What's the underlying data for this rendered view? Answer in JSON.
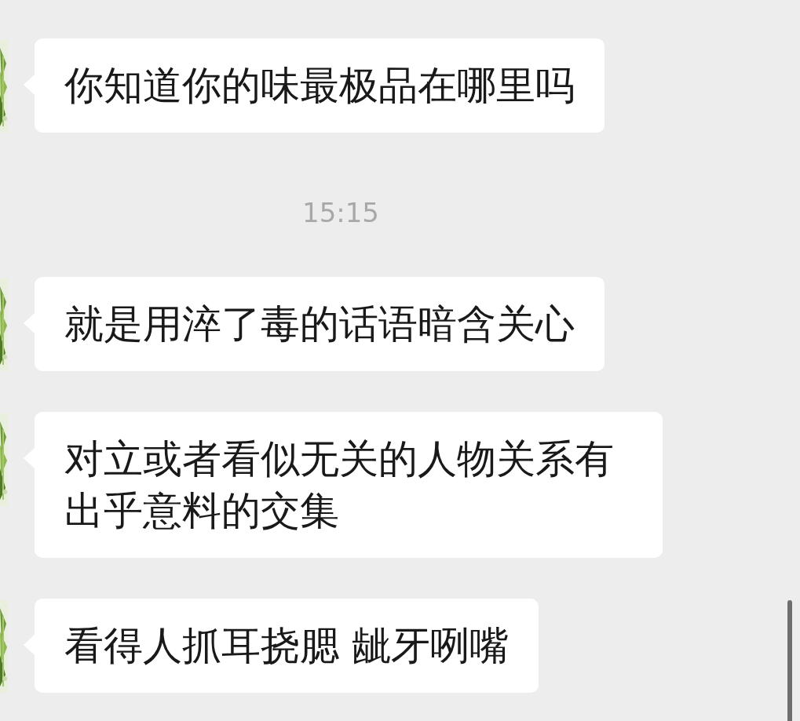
{
  "messages": [
    {
      "kind": "text",
      "text": "你知道你的味最极品在哪里吗"
    },
    {
      "kind": "time",
      "text": "15:15"
    },
    {
      "kind": "text",
      "text": "就是用淬了毒的话语暗含关心"
    },
    {
      "kind": "text",
      "text": "对立或者看似无关的人物关系有出乎意料的交集"
    },
    {
      "kind": "text",
      "text": "看得人抓耳挠腮 龇牙咧嘴"
    }
  ]
}
